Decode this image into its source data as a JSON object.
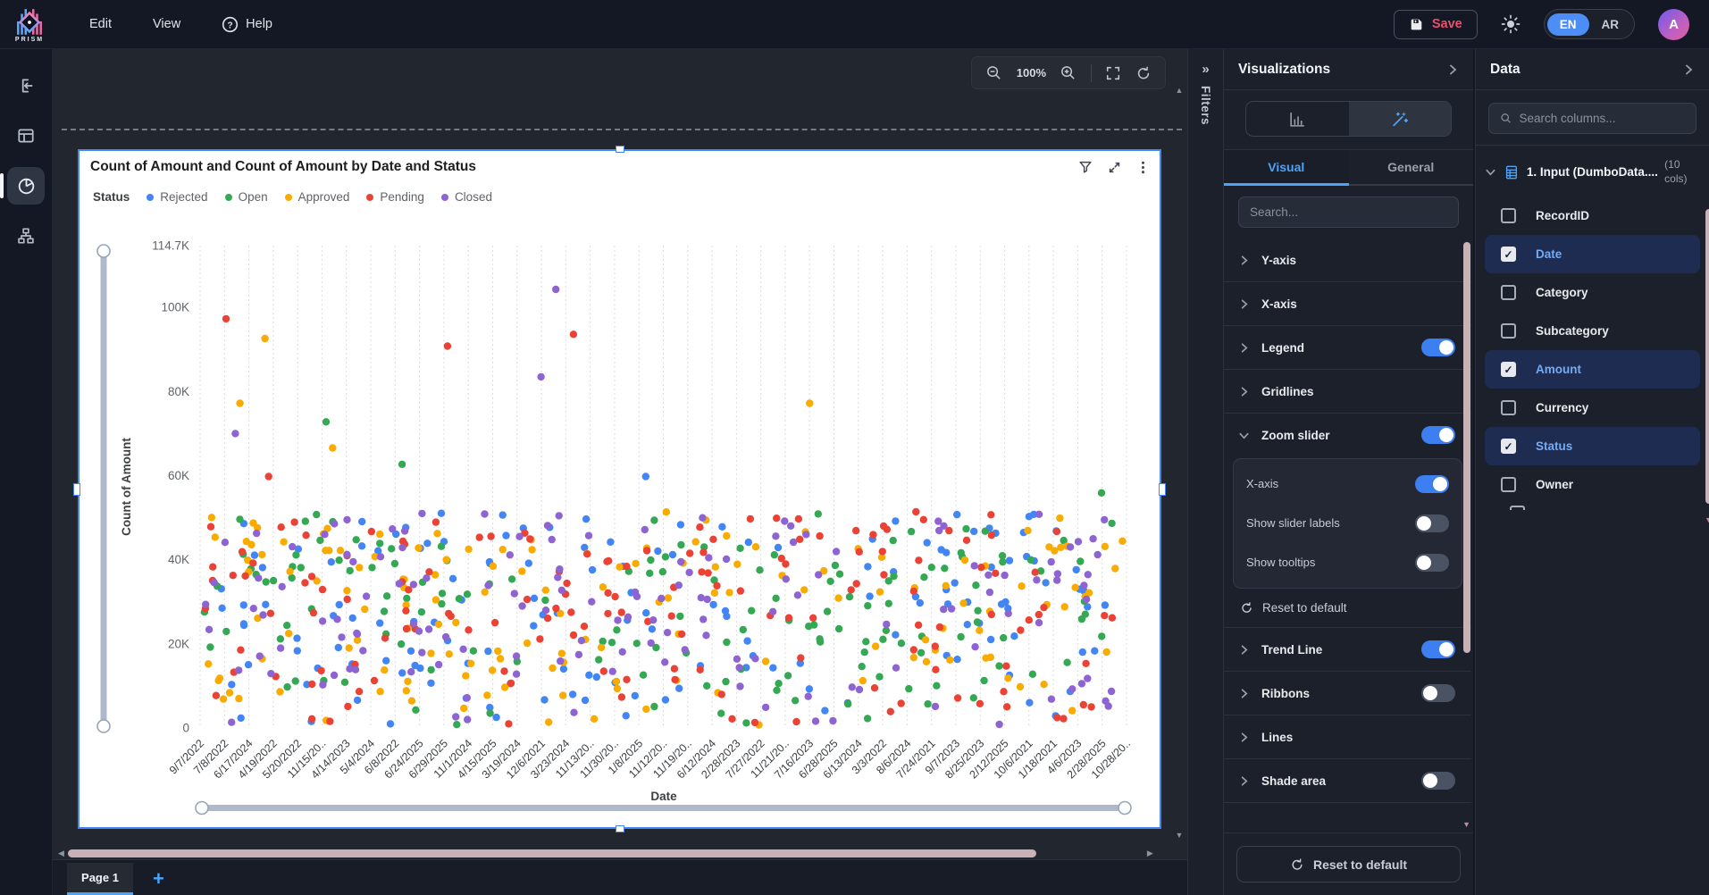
{
  "topbar": {
    "brand": "PRISM",
    "menus": [
      {
        "label": "Edit"
      },
      {
        "label": "View"
      },
      {
        "label": "Help"
      }
    ],
    "save_label": "Save",
    "language": {
      "selected": "EN",
      "options": [
        "EN",
        "AR"
      ]
    },
    "avatar_initial": "A"
  },
  "sidebar": {
    "items": [
      {
        "icon": "exit-icon",
        "active": false
      },
      {
        "icon": "layout-icon",
        "active": false
      },
      {
        "icon": "pie-chart-icon",
        "active": true
      },
      {
        "icon": "flow-icon",
        "active": false
      }
    ]
  },
  "canvas": {
    "zoom_toolbar": {
      "zoom_level": "100%"
    },
    "pages": {
      "tabs": [
        {
          "label": "Page 1",
          "active": true
        }
      ],
      "add_label": "+"
    }
  },
  "filters_rail": {
    "label": "Filters",
    "collapse_glyph": "»"
  },
  "visualizations": {
    "title": "Visualizations",
    "active_type": "magic-wand",
    "tabs": [
      {
        "label": "Visual",
        "active": true
      },
      {
        "label": "General",
        "active": false
      }
    ],
    "search_placeholder": "Search...",
    "sections": [
      {
        "label": "Y-axis"
      },
      {
        "label": "X-axis"
      },
      {
        "label": "Legend",
        "toggle": "on"
      },
      {
        "label": "Gridlines"
      },
      {
        "label": "Zoom slider",
        "toggle": "on",
        "expanded": true,
        "children": [
          {
            "label": "X-axis",
            "toggle": "on"
          },
          {
            "label": "Show slider labels",
            "toggle": "off"
          },
          {
            "label": "Show tooltips",
            "toggle": "off"
          }
        ],
        "reset_label": "Reset to default"
      },
      {
        "label": "Trend Line",
        "toggle": "on"
      },
      {
        "label": "Ribbons",
        "toggle": "off"
      },
      {
        "label": "Lines"
      },
      {
        "label": "Shade area",
        "toggle": "off"
      }
    ],
    "reset_button_label": "Reset to default"
  },
  "data_panel": {
    "title": "Data",
    "search_placeholder": "Search columns...",
    "dataset": {
      "label": "1. Input (DumboData....",
      "cols_note": "(10 cols)"
    },
    "columns": [
      {
        "name": "RecordID",
        "checked": false
      },
      {
        "name": "Date",
        "checked": true
      },
      {
        "name": "Category",
        "checked": false
      },
      {
        "name": "Subcategory",
        "checked": false
      },
      {
        "name": "Amount",
        "checked": true
      },
      {
        "name": "Currency",
        "checked": false
      },
      {
        "name": "Status",
        "checked": true
      },
      {
        "name": "Owner",
        "checked": false
      }
    ]
  },
  "chart_data": {
    "type": "scatter",
    "title": "Count of Amount and Count of Amount by Date and Status",
    "legend_title": "Status",
    "xlabel": "Date",
    "ylabel": "Count of Amount",
    "legend_position": "top",
    "grid": "vertical-dashed",
    "y_axis": {
      "max": 114700,
      "ticks": [
        {
          "label": "114.7K",
          "value": 114700
        },
        {
          "label": "100K",
          "value": 100000
        },
        {
          "label": "80K",
          "value": 80000
        },
        {
          "label": "60K",
          "value": 60000
        },
        {
          "label": "40K",
          "value": 40000
        },
        {
          "label": "20K",
          "value": 20000
        },
        {
          "label": "0",
          "value": 0
        }
      ]
    },
    "x_tick_labels": [
      "9/7/2022",
      "7/8/2022",
      "6/17/2024",
      "4/19/2022",
      "5/20/2022",
      "11/15/20..",
      "4/14/2023",
      "5/4/2024",
      "6/8/2022",
      "6/24/2025",
      "6/29/2025",
      "11/1/2024",
      "4/15/2025",
      "3/19/2024",
      "12/6/2021",
      "3/23/2024",
      "11/13/20..",
      "11/30/20..",
      "1/8/2025",
      "11/12/20..",
      "11/19/20..",
      "6/12/2024",
      "2/28/2023",
      "7/27/2022",
      "11/21/20..",
      "7/16/2023",
      "6/28/2025",
      "6/13/2024",
      "3/3/2022",
      "8/6/2024",
      "7/24/2021",
      "9/7/2023",
      "8/25/2023",
      "2/12/2025",
      "10/6/2021",
      "1/18/2021",
      "4/6/2023",
      "2/28/2025",
      "10/28/20.."
    ],
    "series": [
      {
        "name": "Rejected",
        "color": "#4285F4"
      },
      {
        "name": "Open",
        "color": "#34A853"
      },
      {
        "name": "Approved",
        "color": "#F9AB00"
      },
      {
        "name": "Pending",
        "color": "#EA4335"
      },
      {
        "name": "Closed",
        "color": "#8E63D2"
      }
    ],
    "outlier_points": [
      {
        "series": "Pending",
        "x_frac": 0.028,
        "value": 97300
      },
      {
        "series": "Approved",
        "x_frac": 0.07,
        "value": 92600
      },
      {
        "series": "Approved",
        "x_frac": 0.043,
        "value": 77200
      },
      {
        "series": "Closed",
        "x_frac": 0.038,
        "value": 70000
      },
      {
        "series": "Open",
        "x_frac": 0.136,
        "value": 72800
      },
      {
        "series": "Approved",
        "x_frac": 0.143,
        "value": 66600
      },
      {
        "series": "Pending",
        "x_frac": 0.074,
        "value": 59800
      },
      {
        "series": "Open",
        "x_frac": 0.218,
        "value": 62700
      },
      {
        "series": "Pending",
        "x_frac": 0.267,
        "value": 90800
      },
      {
        "series": "Closed",
        "x_frac": 0.368,
        "value": 83500
      },
      {
        "series": "Closed",
        "x_frac": 0.384,
        "value": 104300
      },
      {
        "series": "Pending",
        "x_frac": 0.403,
        "value": 93600
      },
      {
        "series": "Rejected",
        "x_frac": 0.481,
        "value": 59800
      },
      {
        "series": "Approved",
        "x_frac": 0.658,
        "value": 77200
      },
      {
        "series": "Open",
        "x_frac": 0.973,
        "value": 55900
      }
    ],
    "dense_cloud": {
      "seed": 20,
      "points_per_series": 150,
      "value_min": 600,
      "value_max": 51500,
      "x_frac_range": [
        0.004,
        0.996
      ]
    },
    "zoom_sliders": {
      "vertical": true,
      "horizontal": true
    }
  }
}
